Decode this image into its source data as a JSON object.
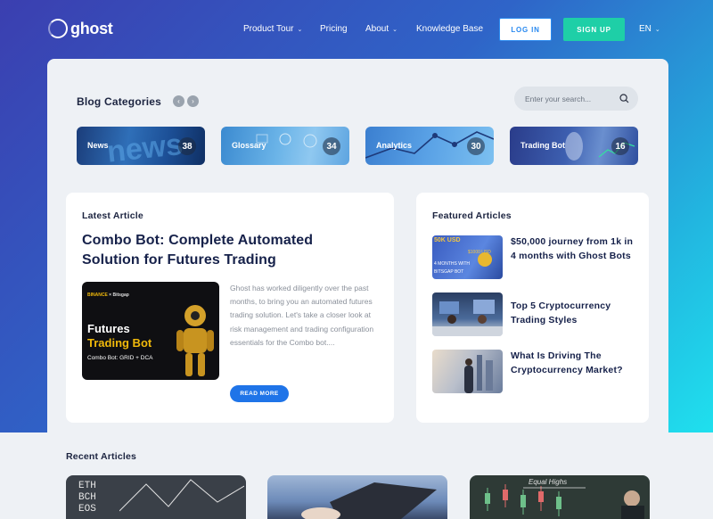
{
  "nav": {
    "logo_text": "ghost",
    "links": [
      {
        "label": "Product Tour",
        "has_dropdown": true
      },
      {
        "label": "Pricing",
        "has_dropdown": false
      },
      {
        "label": "About",
        "has_dropdown": true
      },
      {
        "label": "Knowledge Base",
        "has_dropdown": false
      }
    ],
    "login_label": "LOG IN",
    "signup_label": "SIGN UP",
    "language": "EN"
  },
  "categories": {
    "title": "Blog Categories",
    "search_placeholder": "Enter your search...",
    "items": [
      {
        "label": "News",
        "count": "38"
      },
      {
        "label": "Glossary",
        "count": "34"
      },
      {
        "label": "Analytics",
        "count": "30"
      },
      {
        "label": "Trading Bot",
        "count": "16"
      }
    ]
  },
  "latest": {
    "section_title": "Latest Article",
    "headline": "Combo Bot: Complete Automated Solution for Futures Trading",
    "image_brand": "BINANCE",
    "image_brand_partner": "× Bitsgap",
    "image_title_1": "Futures",
    "image_title_2": "Trading Bot",
    "image_subtitle": "Combo Bot: GRID + DCA",
    "excerpt": "Ghost has worked diligently over the past months, to bring you an automated futures trading solution. Let's take a closer look at risk management and trading configuration essentials for the Combo bot....",
    "read_more_label": "READ MORE"
  },
  "featured": {
    "section_title": "Featured Articles",
    "items": [
      {
        "title": "$50,000 journey from 1k in 4 months with Ghost Bots",
        "thumb_text_1": "50K USD",
        "thumb_text_2": "$1000 USD",
        "thumb_text_3": "4 MONTHS WITH",
        "thumb_text_4": "BITSGAP BOT"
      },
      {
        "title": "Top 5 Cryptocurrency Trading Styles"
      },
      {
        "title": "What Is Driving The Cryptocurrency Market?"
      }
    ]
  },
  "recent": {
    "section_title": "Recent Articles",
    "card1_text": [
      "ETH",
      "BCH",
      "EOS"
    ],
    "card3_text": "Equal Highs"
  },
  "colors": {
    "accent_blue": "#1f74e8",
    "signup_green": "#1ecfa7",
    "hero_gradient_start": "#3b3fb0",
    "hero_gradient_end": "#1fe0ee"
  }
}
